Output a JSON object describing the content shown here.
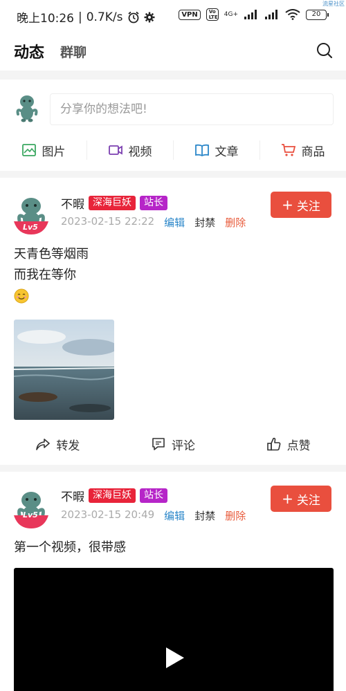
{
  "status_bar": {
    "time": "晚上10:26",
    "speed": "0.7K/s",
    "vpn": "VPN",
    "volte": "Vo LTE",
    "network": "4G+",
    "battery": "20",
    "corner_tag": "流星社区"
  },
  "header": {
    "tabs": [
      {
        "label": "动态",
        "active": true
      },
      {
        "label": "群聊",
        "active": false
      }
    ],
    "search_icon": "search-icon"
  },
  "composer": {
    "placeholder": "分享你的想法吧!",
    "actions": [
      {
        "label": "图片",
        "icon": "image-icon",
        "color": "#3aa760"
      },
      {
        "label": "视频",
        "icon": "video-icon",
        "color": "#7b3fb0"
      },
      {
        "label": "文章",
        "icon": "book-icon",
        "color": "#2a86c9"
      },
      {
        "label": "商品",
        "icon": "cart-icon",
        "color": "#e94f3e"
      }
    ]
  },
  "posts": [
    {
      "author": "不暇",
      "badge_1": "深海巨妖",
      "badge_2": "站长",
      "level": "Lv5",
      "time": "2023-02-15 22:22",
      "edit": "编辑",
      "ban": "封禁",
      "delete": "删除",
      "follow": "关注",
      "text_lines": [
        "天青色等烟雨",
        "而我在等你"
      ],
      "emoji": "smile-emoji",
      "media": "beach-photo",
      "actions": {
        "share": "转发",
        "comment": "评论",
        "like": "点赞"
      }
    },
    {
      "author": "不暇",
      "badge_1": "深海巨妖",
      "badge_2": "站长",
      "level": "Lv5",
      "time": "2023-02-15 20:49",
      "edit": "编辑",
      "ban": "封禁",
      "delete": "删除",
      "follow": "关注",
      "text_lines": [
        "第一个视频，很带感"
      ],
      "media": "video-player"
    }
  ],
  "colors": {
    "accent_red": "#e94f3e",
    "badge_red": "#e8243a",
    "badge_purple": "#b625c8",
    "link_blue": "#2a86c9"
  }
}
